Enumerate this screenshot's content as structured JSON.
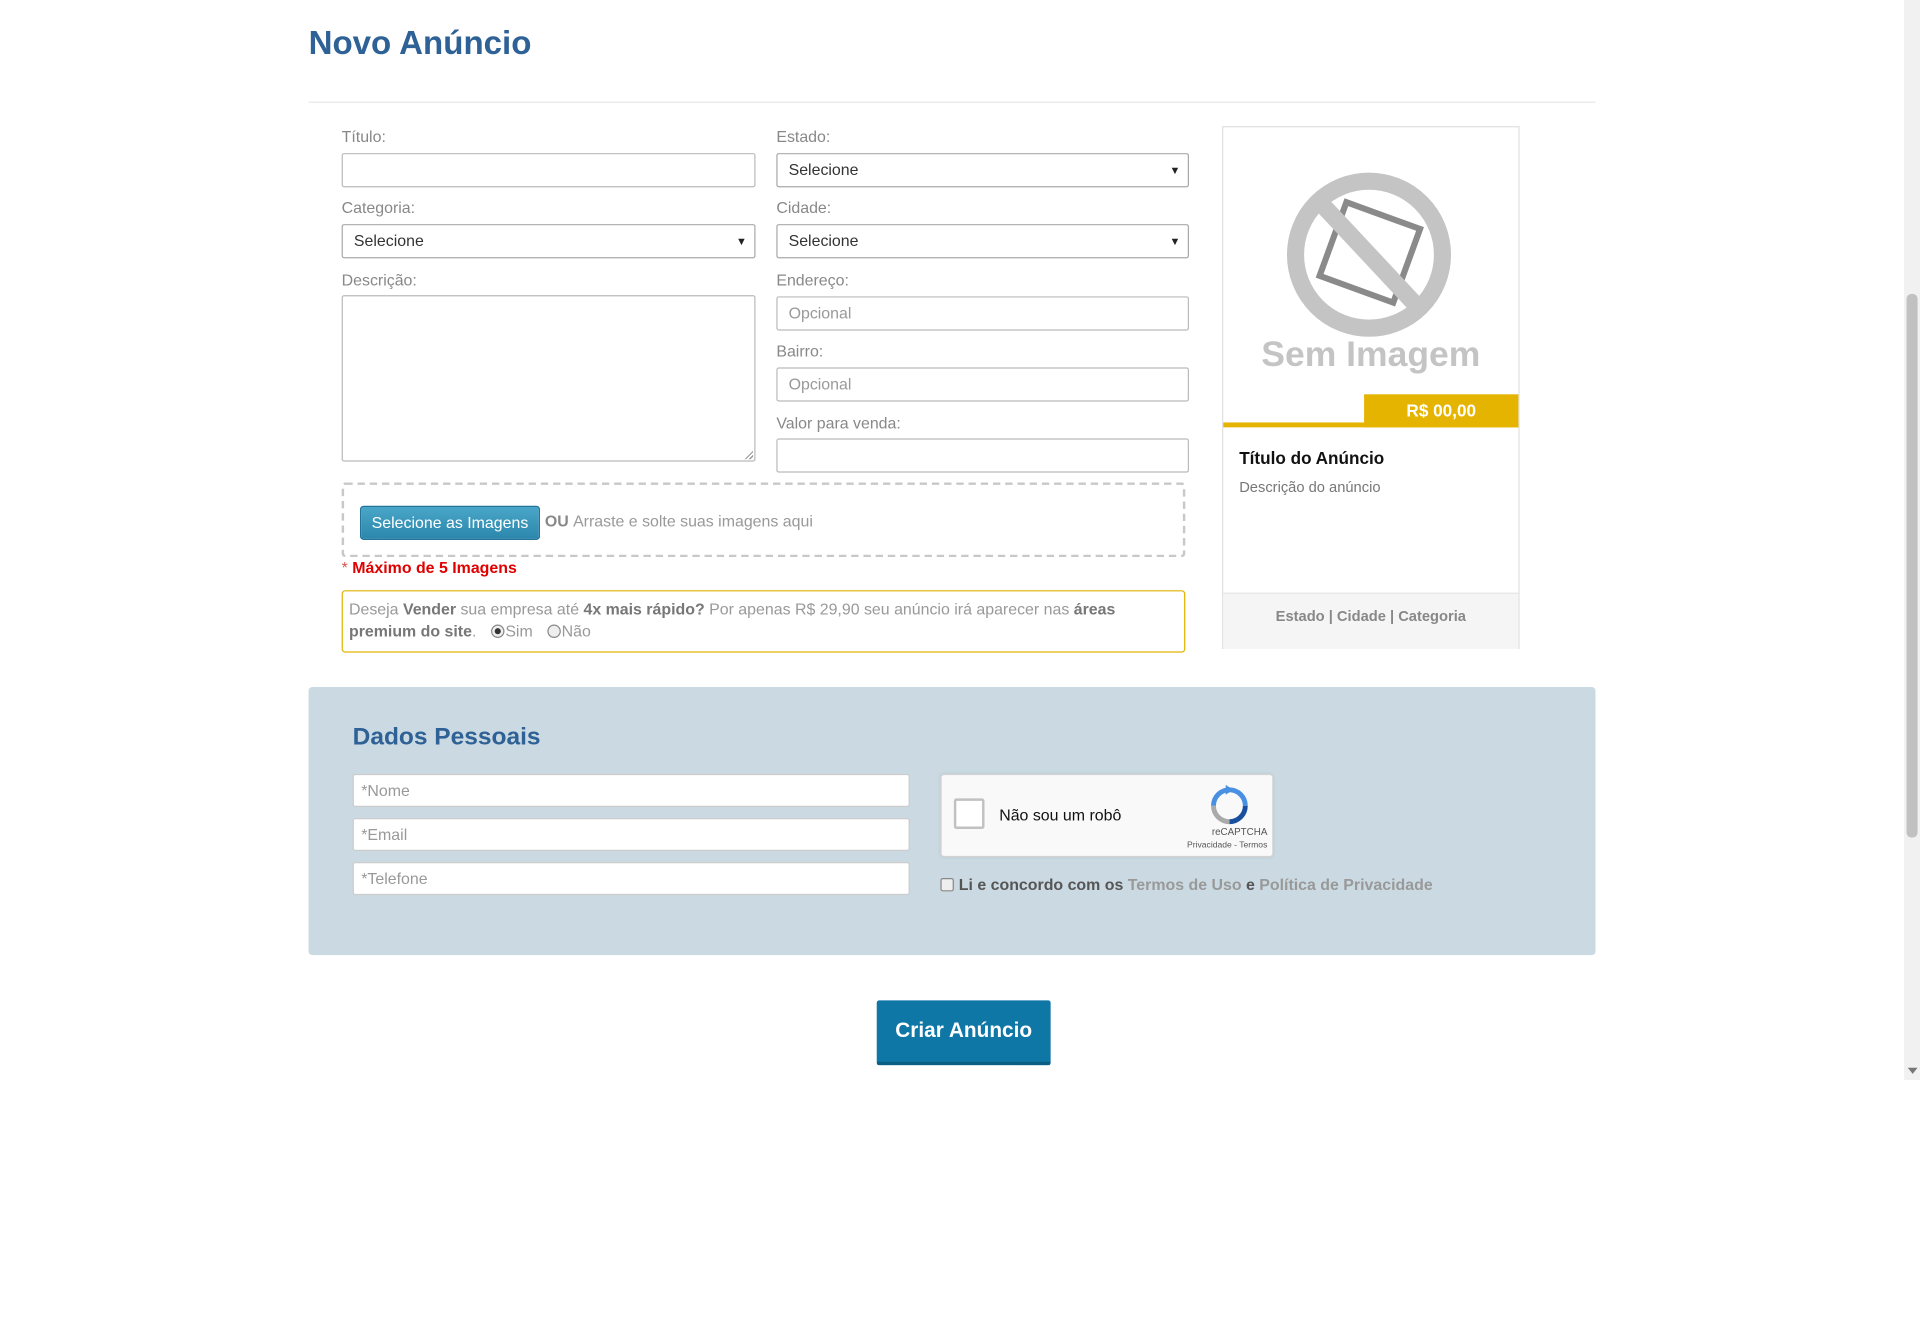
{
  "page": {
    "title": "Novo Anúncio"
  },
  "form": {
    "titulo_label": "Título:",
    "titulo_value": "",
    "estado_label": "Estado:",
    "estado_value": "Selecione",
    "categoria_label": "Categoria:",
    "categoria_value": "Selecione",
    "cidade_label": "Cidade:",
    "cidade_value": "Selecione",
    "descricao_label": "Descrição:",
    "endereco_label": "Endereço:",
    "endereco_placeholder": "Opcional",
    "bairro_label": "Bairro:",
    "bairro_placeholder": "Opcional",
    "valor_label": "Valor para venda:",
    "valor_value": ""
  },
  "upload": {
    "button_label": "Selecione as Imagens",
    "or_text": "OU",
    "drop_text": "Arraste e solte suas imagens aqui",
    "max_star": "*",
    "max_text": "Máximo de 5 Imagens"
  },
  "premium": {
    "p1": "Deseja ",
    "b1": "Vender",
    "p2": " sua empresa até ",
    "b2": "4x mais rápido?",
    "p3": " Por apenas R$ 29,90 seu anúncio irá aparecer nas ",
    "b3": "áreas premium do site",
    "p4": ".",
    "yes_label": "Sim",
    "no_label": "Não",
    "selected": "Sim"
  },
  "preview": {
    "no_image_text": "Sem Imagem",
    "price": "R$ 00,00",
    "title": "Título do Anúncio",
    "description": "Descrição do anúncio",
    "footer": "Estado | Cidade | Categoria",
    "accent_color": "#e5b400"
  },
  "personal": {
    "title": "Dados Pessoais",
    "name_placeholder": "*Nome",
    "email_placeholder": "*Email",
    "phone_placeholder": "*Telefone",
    "captcha_label": "Não sou um robô",
    "captcha_brand": "reCAPTCHA",
    "captcha_links": "Privacidade - Termos",
    "terms_prefix": "Li e concordo com os ",
    "terms_link": "Termos de Uso",
    "terms_and": " e ",
    "privacy_link": "Política de Privacidade"
  },
  "submit_label": "Criar Anúncio",
  "colors": {
    "heading": "#2e6196",
    "panel_bg": "#cbdae2",
    "button": "#0f77a6"
  }
}
